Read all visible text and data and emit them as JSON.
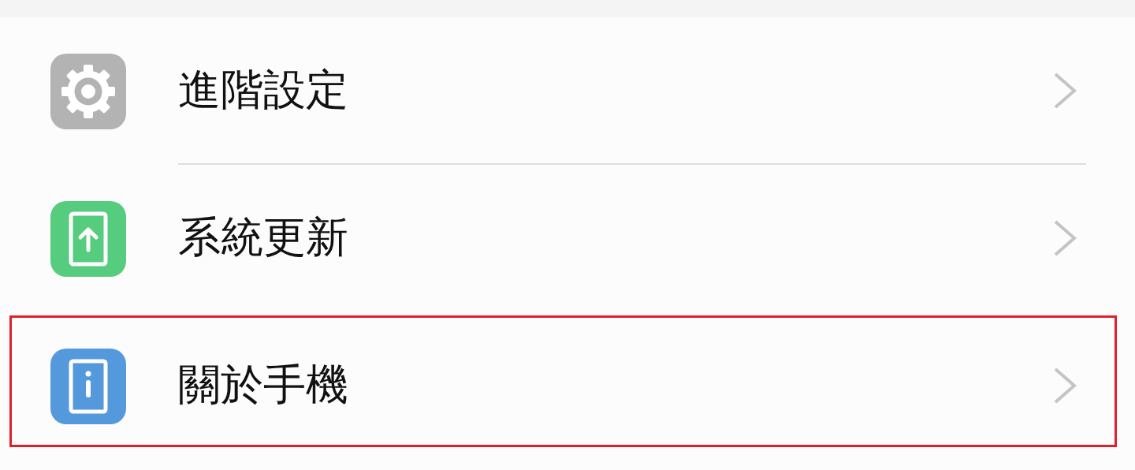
{
  "settings_items": [
    {
      "kind": "gear",
      "color": "#b3b3b3",
      "label": "進階設定",
      "divider_below": true,
      "highlighted": false
    },
    {
      "kind": "update",
      "color": "#55cc7e",
      "label": "系統更新",
      "divider_below": false,
      "highlighted": false
    },
    {
      "kind": "info",
      "color": "#5599dd",
      "label": "關於手機",
      "divider_below": false,
      "highlighted": true
    }
  ]
}
